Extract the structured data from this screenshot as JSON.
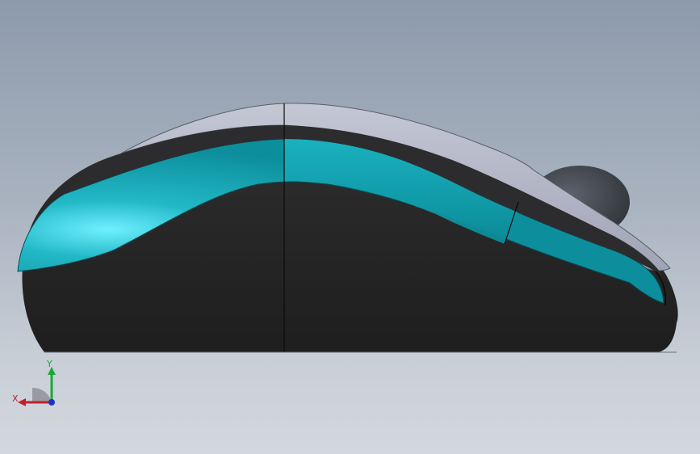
{
  "viewport": {
    "background_top": "#8d9aab",
    "background_bottom": "#d3d8de"
  },
  "model": {
    "shell_color": "#2a2a2a",
    "accent_color": "#18a9b6",
    "top_color": "#b8bccb",
    "wheel_color": "#4a5058"
  },
  "triad": {
    "x_label": "X",
    "y_label": "Y",
    "x_color": "#c0202a",
    "y_color": "#1aa83a",
    "z_color": "#2030c8"
  }
}
